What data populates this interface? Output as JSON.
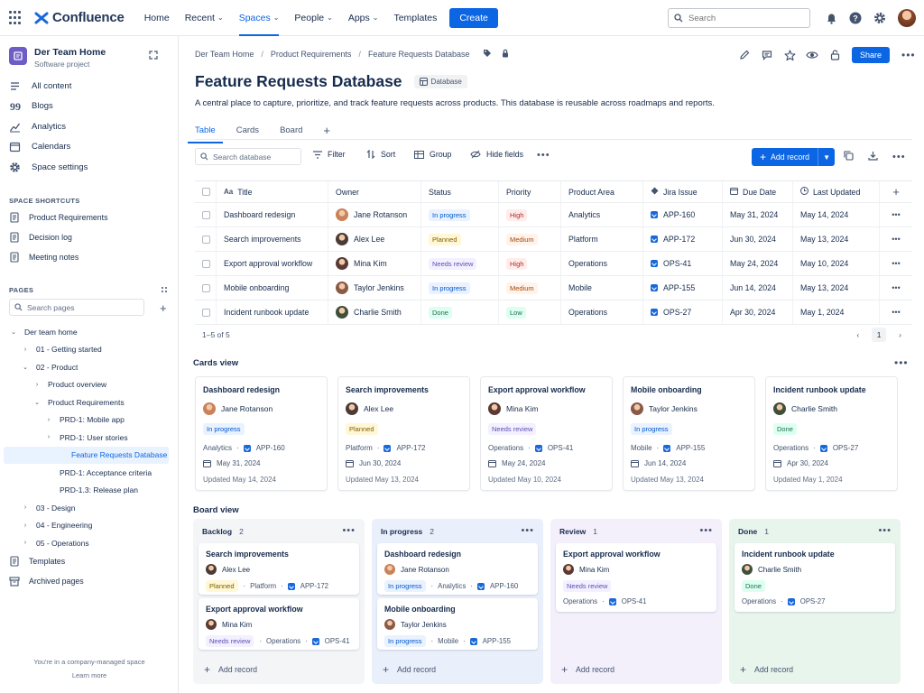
{
  "topnav": {
    "logo": "Confluence",
    "items": [
      {
        "label": "Home",
        "chevron": false
      },
      {
        "label": "Recent",
        "chevron": true
      },
      {
        "label": "Spaces",
        "chevron": true,
        "active": true
      },
      {
        "label": "People",
        "chevron": true
      },
      {
        "label": "Apps",
        "chevron": true
      },
      {
        "label": "Templates",
        "chevron": false
      }
    ],
    "create": "Create",
    "search_placeholder": "Search"
  },
  "sidebar": {
    "space_name": "Der Team Home",
    "space_sub": "Software project",
    "main_items": [
      "All content",
      "Blogs",
      "Analytics",
      "Calendars",
      "Space settings"
    ],
    "shortcuts_title": "SPACE SHORTCUTS",
    "shortcuts": [
      "Product Requirements",
      "Decision log",
      "Meeting notes"
    ],
    "pages_title": "PAGES",
    "pages_search": "Search pages",
    "tree": [
      {
        "label": "Der team home",
        "indent": 0,
        "twisty": "⌄"
      },
      {
        "label": "01 - Getting started",
        "indent": 1,
        "twisty": "›"
      },
      {
        "label": "02 - Product",
        "indent": 1,
        "twisty": "⌄"
      },
      {
        "label": "Product overview",
        "indent": 2,
        "twisty": "›"
      },
      {
        "label": "Product Requirements",
        "indent": 2,
        "twisty": "⌄"
      },
      {
        "label": "PRD-1: Mobile app",
        "indent": 3,
        "twisty": "›"
      },
      {
        "label": "PRD-1: User stories",
        "indent": 3,
        "twisty": "›"
      },
      {
        "label": "Feature Requests Database",
        "indent": 4,
        "twisty": "",
        "active": true
      },
      {
        "label": "PRD-1: Acceptance criteria",
        "indent": 3,
        "twisty": ""
      },
      {
        "label": "PRD-1.3: Release plan",
        "indent": 3,
        "twisty": ""
      },
      {
        "label": "03 - Design",
        "indent": 1,
        "twisty": "›"
      },
      {
        "label": "04 - Engineering",
        "indent": 1,
        "twisty": "›"
      },
      {
        "label": "05 - Operations",
        "indent": 1,
        "twisty": "›"
      }
    ],
    "bottom": [
      "Templates",
      "Archived pages"
    ],
    "footer_text": "You're in a company-managed space",
    "footer_link": "Learn more"
  },
  "breadcrumb": [
    "Der Team Home",
    "Product Requirements",
    "Feature Requests Database"
  ],
  "share": "Share",
  "page": {
    "title": "Feature Requests Database",
    "badge": "Database",
    "description": "A central place to capture, prioritize, and track feature requests across products. This database is reusable across roadmaps and reports."
  },
  "tabs": [
    "Table",
    "Cards",
    "Board"
  ],
  "toolbar": {
    "search_placeholder": "Search database",
    "filter": "Filter",
    "sort": "Sort",
    "group": "Group",
    "hide": "Hide fields",
    "add_record": "Add record"
  },
  "table": {
    "headers": {
      "title": "Title",
      "owner": "Owner",
      "status": "Status",
      "priority": "Priority",
      "area": "Product Area",
      "jira": "Jira Issue",
      "due": "Due Date",
      "updated": "Last Updated"
    },
    "rows": [
      {
        "title": "Dashboard redesign",
        "owner": "Jane Rotanson",
        "status": "In progress",
        "status_class": "st-prog",
        "priority": "High",
        "priority_class": "pr-high",
        "area": "Analytics",
        "jira": "APP-160",
        "due": "May 31, 2024",
        "updated": "May 14, 2024",
        "ava": "#c9825a"
      },
      {
        "title": "Search improvements",
        "owner": "Alex Lee",
        "status": "Planned",
        "status_class": "st-plan",
        "priority": "Medium",
        "priority_class": "pr-med",
        "area": "Platform",
        "jira": "APP-172",
        "due": "Jun 30, 2024",
        "updated": "May 13, 2024",
        "ava": "#4a3b35"
      },
      {
        "title": "Export approval workflow",
        "owner": "Mina Kim",
        "status": "Needs review",
        "status_class": "st-rev",
        "priority": "High",
        "priority_class": "pr-high",
        "area": "Operations",
        "jira": "OPS-41",
        "due": "May 24, 2024",
        "updated": "May 10, 2024",
        "ava": "#5b3a33"
      },
      {
        "title": "Mobile onboarding",
        "owner": "Taylor Jenkins",
        "status": "In progress",
        "status_class": "st-prog",
        "priority": "Medium",
        "priority_class": "pr-med",
        "area": "Mobile",
        "jira": "APP-155",
        "due": "Jun 14, 2024",
        "updated": "May 13, 2024",
        "ava": "#8a5a46"
      },
      {
        "title": "Incident runbook update",
        "owner": "Charlie Smith",
        "status": "Done",
        "status_class": "st-done",
        "priority": "Low",
        "priority_class": "pr-low",
        "area": "Operations",
        "jira": "OPS-27",
        "due": "Apr 30, 2024",
        "updated": "May 1, 2024",
        "ava": "#3f4f3a"
      }
    ],
    "count": "1–5 of 5",
    "page": "1"
  },
  "cards_title": "Cards view",
  "cards_updated_prefix": "Updated",
  "board_title": "Board view",
  "board": [
    {
      "name": "Backlog",
      "count": "2",
      "cls": "c1",
      "cards": [
        {
          "title": "Search improvements",
          "owner": "Alex Lee",
          "status": "Planned",
          "status_class": "st-plan",
          "area": "Platform",
          "jira": "APP-172",
          "ava": "#4a3b35"
        },
        {
          "title": "Export approval workflow",
          "owner": "Mina Kim",
          "status": "Needs review",
          "status_class": "st-rev",
          "area": "Operations",
          "jira": "OPS-41",
          "ava": "#5b3a33"
        }
      ]
    },
    {
      "name": "In progress",
      "count": "2",
      "cls": "c2",
      "cards": [
        {
          "title": "Dashboard redesign",
          "owner": "Jane Rotanson",
          "status": "In progress",
          "status_class": "st-prog",
          "area": "Analytics",
          "jira": "APP-160",
          "ava": "#c9825a"
        },
        {
          "title": "Mobile onboarding",
          "owner": "Taylor Jenkins",
          "status": "In progress",
          "status_class": "st-prog",
          "area": "Mobile",
          "jira": "APP-155",
          "ava": "#8a5a46"
        }
      ]
    },
    {
      "name": "Review",
      "count": "1",
      "cls": "c3",
      "cards": [
        {
          "title": "Export approval workflow",
          "owner": "Mina Kim",
          "status": "Needs review",
          "status_class": "st-rev",
          "area": "Operations",
          "jira": "OPS-41",
          "ava": "#5b3a33",
          "stacked": true
        }
      ]
    },
    {
      "name": "Done",
      "count": "1",
      "cls": "c4",
      "cards": [
        {
          "title": "Incident runbook update",
          "owner": "Charlie Smith",
          "status": "Done",
          "status_class": "st-done",
          "area": "Operations",
          "jira": "OPS-27",
          "ava": "#3f4f3a",
          "stacked": true
        }
      ]
    }
  ],
  "board_add": "Add record"
}
